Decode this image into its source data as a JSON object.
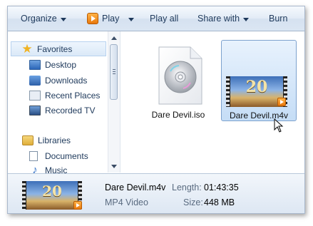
{
  "toolbar": {
    "organize": "Organize",
    "play": "Play",
    "play_all": "Play all",
    "share_with": "Share with",
    "burn": "Burn"
  },
  "nav": {
    "favorites": "Favorites",
    "items": [
      "Desktop",
      "Downloads",
      "Recent Places",
      "Recorded TV"
    ],
    "libraries": "Libraries",
    "library_items": [
      "Documents",
      "Music"
    ]
  },
  "files": [
    {
      "name": "Dare Devil.iso",
      "icon": "disc-image-icon",
      "selected": false
    },
    {
      "name": "Dare Devil.m4v",
      "icon": "video-thumbnail",
      "selected": true
    }
  ],
  "thumbnail_logo": "20",
  "details": {
    "filename": "Dare Devil.m4v",
    "type": "MP4 Video",
    "length_label": "Length:",
    "length_value": "01:43:35",
    "size_label": "Size:",
    "size_value": "448 MB"
  },
  "colors": {
    "toolbar_bg": "#dbe6f3",
    "selection_bg": "#c5ddf6",
    "selection_border": "#7da2ce",
    "text": "#1e395b"
  }
}
